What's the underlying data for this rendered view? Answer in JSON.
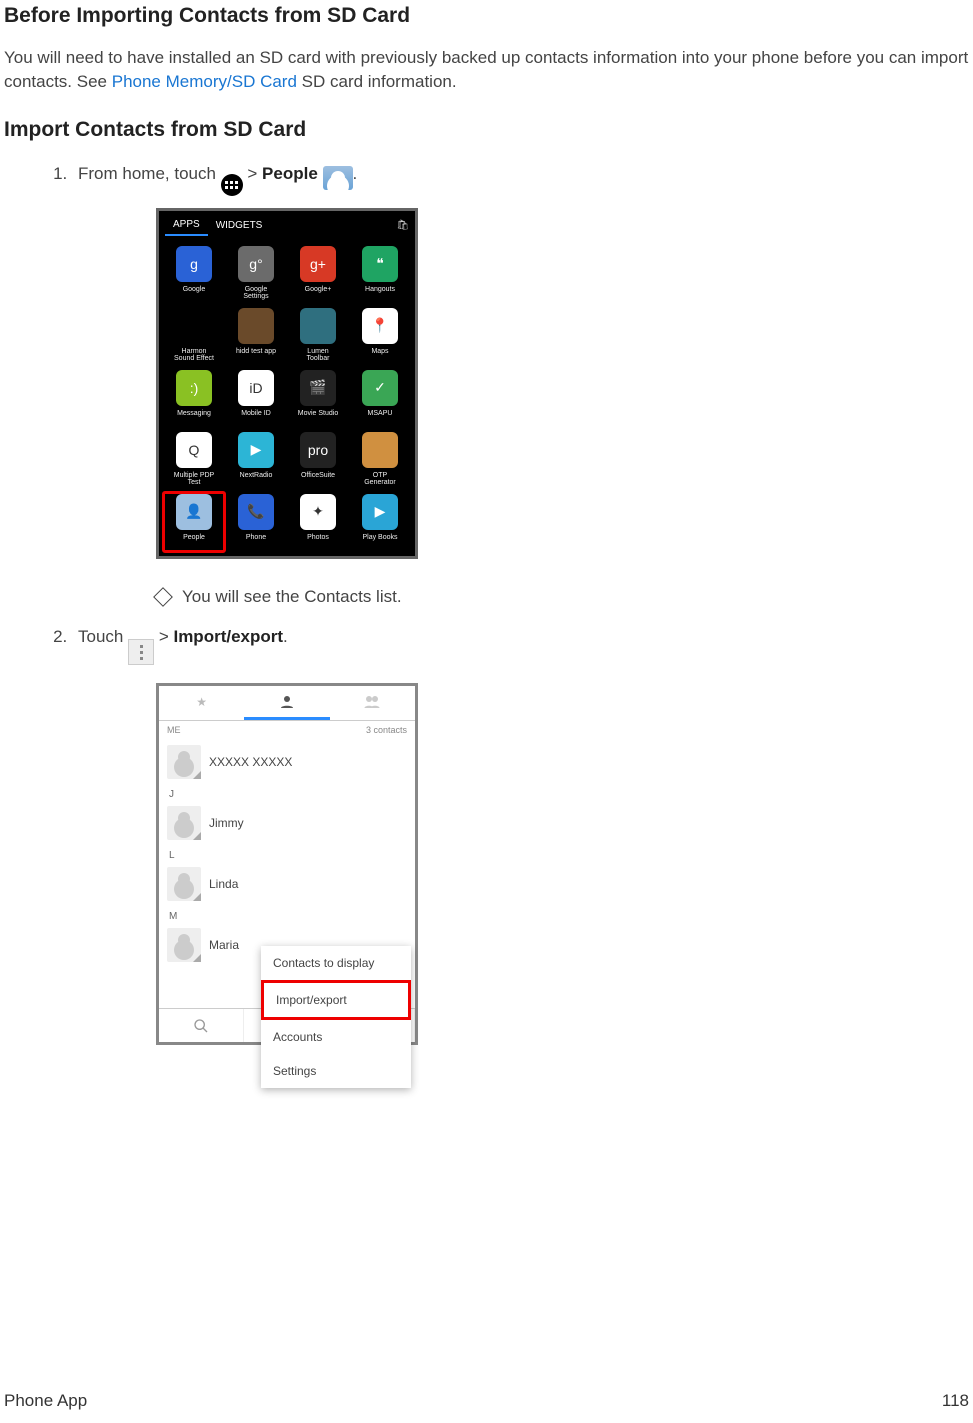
{
  "headings": {
    "before": "Before Importing Contacts from SD Card",
    "import": "Import Contacts from SD Card"
  },
  "intro": {
    "before_link": "You will need to have installed an SD card with previously backed up contacts information into your phone before you can import contacts. See ",
    "link": "Phone Memory/SD Card",
    "after_link": " SD card information."
  },
  "step1": {
    "pre": "From home, touch ",
    "gt": " > ",
    "people": "People",
    "period": "."
  },
  "note1": "You will see the Contacts list.",
  "step2": {
    "pre": "Touch ",
    "gt": " > ",
    "label": "Import/export",
    "period": "."
  },
  "screenshot1": {
    "tabs": {
      "apps": "APPS",
      "widgets": "WIDGETS"
    },
    "apps": [
      {
        "label": "Google",
        "color": "#2a62d6",
        "letter": "g"
      },
      {
        "label": "Google\nSettings",
        "color": "#6b6b6b",
        "letter": "g°"
      },
      {
        "label": "Google+",
        "color": "#d73925",
        "letter": "g+"
      },
      {
        "label": "Hangouts",
        "color": "#1fa463",
        "letter": "❝"
      },
      {
        "label": "Harmon\nSound Effect",
        "color": "#000",
        "letter": ""
      },
      {
        "label": "hidd test app",
        "color": "#6a4a2a",
        "letter": ""
      },
      {
        "label": "Lumen\nToolbar",
        "color": "#2f6f7f",
        "letter": ""
      },
      {
        "label": "Maps",
        "color": "#fff",
        "letter": "📍"
      },
      {
        "label": "Messaging",
        "color": "#8ac123",
        "letter": ":)"
      },
      {
        "label": "Mobile ID",
        "color": "#fff",
        "letter": "iD"
      },
      {
        "label": "Movie Studio",
        "color": "#222",
        "letter": "🎬"
      },
      {
        "label": "MSAPU",
        "color": "#3aa655",
        "letter": "✓"
      },
      {
        "label": "Multiple PDP\nTest",
        "color": "#fff",
        "letter": "Q"
      },
      {
        "label": "NextRadio",
        "color": "#2cb5d6",
        "letter": "▶"
      },
      {
        "label": "OfficeSuite",
        "color": "#222",
        "letter": "pro"
      },
      {
        "label": "OTP\nGenerator",
        "color": "#d09040",
        "letter": ""
      },
      {
        "label": "People",
        "color": "#9dbfe0",
        "letter": "👤"
      },
      {
        "label": "Phone",
        "color": "#2a62d6",
        "letter": "📞"
      },
      {
        "label": "Photos",
        "color": "#fff",
        "letter": "✦"
      },
      {
        "label": "Play Books",
        "color": "#2aa5d6",
        "letter": "▶"
      }
    ]
  },
  "screenshot2": {
    "me": "ME",
    "count": "3 contacts",
    "contacts": [
      {
        "letter": "",
        "name": "XXXXX XXXXX"
      },
      {
        "letter": "J",
        "name": "Jimmy"
      },
      {
        "letter": "L",
        "name": "Linda"
      },
      {
        "letter": "M",
        "name": "Maria"
      }
    ],
    "menu": [
      "Contacts to display",
      "Import/export",
      "Accounts",
      "Settings"
    ]
  },
  "footer": {
    "left": "Phone App",
    "right": "118"
  }
}
